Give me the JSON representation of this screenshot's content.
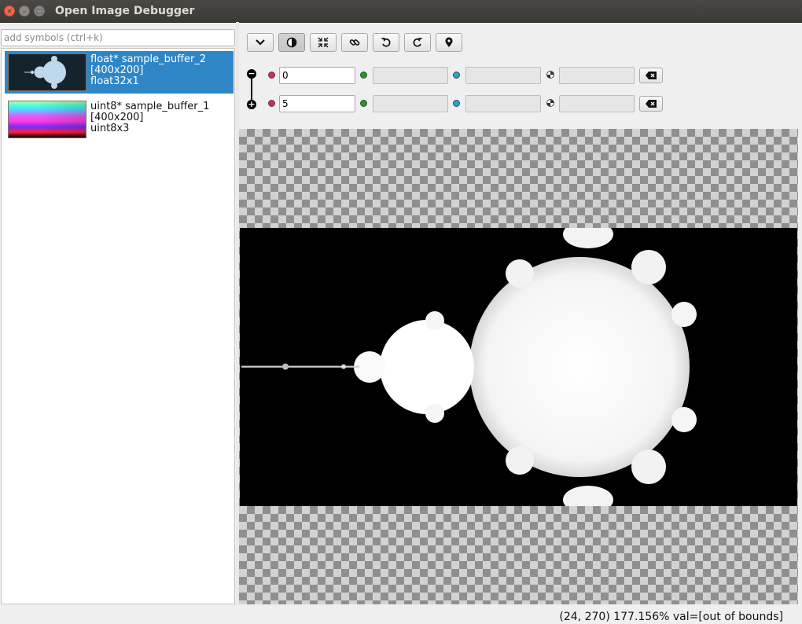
{
  "window": {
    "title": "Open Image Debugger",
    "close_glyph": "×",
    "minimize_glyph": "–",
    "maximize_glyph": "□"
  },
  "search": {
    "placeholder": "add symbols (ctrl+k)",
    "value": ""
  },
  "buffers": [
    {
      "name": "float* sample_buffer_2",
      "size": "[400x200]",
      "type": "float32x1",
      "selected": true,
      "thumbnail": "mandelbrot-grayscale"
    },
    {
      "name": "uint8* sample_buffer_1",
      "size": "[400x200]",
      "type": "uint8x3",
      "selected": false,
      "thumbnail": "color-gradient"
    }
  ],
  "toolbar": [
    {
      "name": "expand-icon",
      "active": false
    },
    {
      "name": "contrast-icon",
      "active": true
    },
    {
      "name": "fit-to-window-icon",
      "active": false
    },
    {
      "name": "link-views-icon",
      "active": false
    },
    {
      "name": "rotate-left-icon",
      "active": false
    },
    {
      "name": "rotate-right-icon",
      "active": false
    },
    {
      "name": "go-to-pixel-icon",
      "active": false
    }
  ],
  "contrast": {
    "min_label_glyph": "−",
    "max_label_glyph": "+",
    "min_row": {
      "red": "0",
      "green": "",
      "blue": "",
      "alpha": ""
    },
    "max_row": {
      "red": "5",
      "green": "",
      "blue": "",
      "alpha": ""
    }
  },
  "status": {
    "text": "(24, 270) 177.156% val=[out of bounds]"
  },
  "colors": {
    "selection": "#2f86c7",
    "red_channel": "#e0245e",
    "green_channel": "#16a116",
    "blue_channel": "#2aa3d5",
    "close_button": "#f0674e"
  }
}
